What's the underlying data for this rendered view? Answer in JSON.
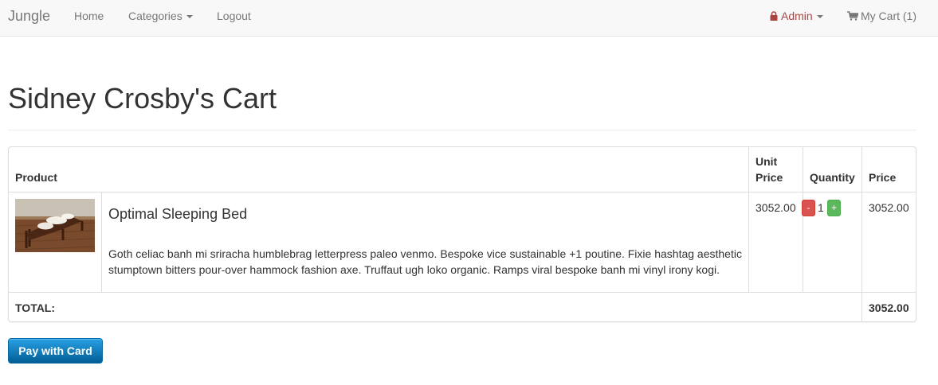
{
  "navbar": {
    "brand": "Jungle",
    "links": {
      "home": "Home",
      "categories": "Categories",
      "logout": "Logout"
    },
    "admin": "Admin",
    "cart": "My Cart (1)",
    "colors": {
      "admin": "#a94442",
      "link": "#777777",
      "background": "#f8f8f8"
    }
  },
  "page": {
    "title": "Sidney Crosby's Cart"
  },
  "cart_table": {
    "headers": {
      "product": "Product",
      "unit_price_line1": "Unit",
      "unit_price_line2": "Price",
      "quantity": "Quantity",
      "price": "Price"
    },
    "items": [
      {
        "name": "Optimal Sleeping Bed",
        "description": "Goth celiac banh mi sriracha humblebrag letterpress paleo venmo. Bespoke vice sustainable +1 poutine. Fixie hashtag aesthetic stumptown bitters pour-over hammock fashion axe. Truffaut ugh loko organic. Ramps viral bespoke banh mi vinyl irony kogi.",
        "unit_price": "3052.00",
        "quantity": "1",
        "decrement_label": "-",
        "increment_label": "+",
        "price": "3052.00",
        "image_icon": "bed-photo"
      }
    ],
    "total_label": "TOTAL:",
    "total_value": "3052.00"
  },
  "pay_button": {
    "label": "Pay with Card",
    "color": "#1a8ad0"
  }
}
